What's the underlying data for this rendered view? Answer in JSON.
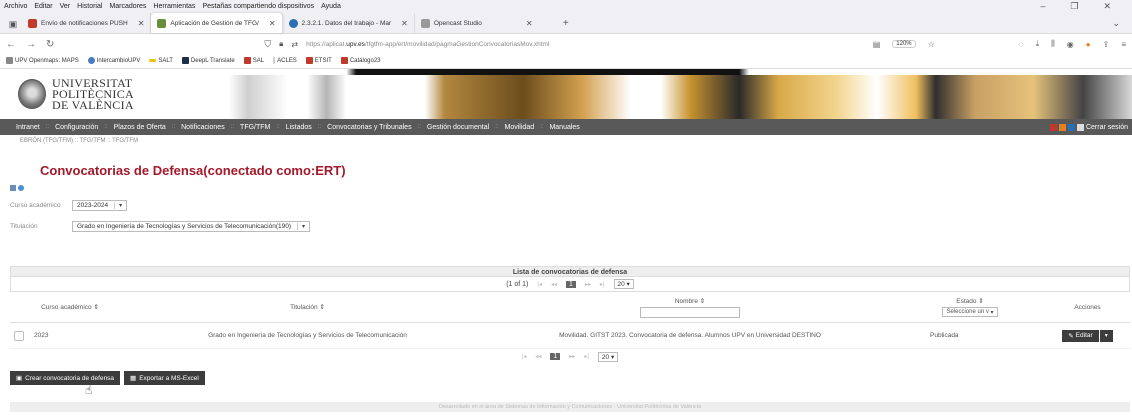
{
  "browser": {
    "menu": [
      "Archivo",
      "Editar",
      "Ver",
      "Historial",
      "Marcadores",
      "Herramientas",
      "Pestañas compartiendo dispositivos",
      "Ayuda"
    ],
    "tabs": [
      {
        "label": "Envío de notificaciones PUSH",
        "color": "#c0392b"
      },
      {
        "label": "Aplicación de Gestión de TFG/",
        "color": "#6a8f3a"
      },
      {
        "label": "2.3.2.1. Datos del trabajo - Mar",
        "color": "#2a6fb5"
      },
      {
        "label": "Opencast Studio",
        "color": "#999999"
      }
    ],
    "url_prefix": "https://aplicat.",
    "url_domain": "upv.es",
    "url_rest": "/tfgtfm-app/ert/movilidad/pagmaGestionConvocatoriasMov.xhtml",
    "zoom": "120%",
    "bookmarks": [
      {
        "label": "UPV Openmaps: MAPS",
        "color": "#888888"
      },
      {
        "label": "IntercambioUPV",
        "color": "#4a7abf"
      },
      {
        "label": "SALT",
        "color": "#f1c40f"
      },
      {
        "label": "DeepL Translate",
        "color": "#1c2e4a"
      },
      {
        "label": "SAL",
        "color": "#c0392b"
      },
      {
        "label": "ACLES",
        "color": "#cccccc"
      },
      {
        "label": "ETSIT",
        "color": "#c0392b"
      },
      {
        "label": "Catálogo23",
        "color": "#c0392b"
      }
    ]
  },
  "site": {
    "logo_lines": [
      "UNIVERSITAT",
      "POLITÈCNICA",
      "DE VALÈNCIA"
    ],
    "nav": [
      "Intranet",
      "Configuración",
      "Plazos de Oferta",
      "Notificaciones",
      "TFG/TFM",
      "Listados",
      "Convocatorias y Tribunales",
      "Gestión documental",
      "Movilidad",
      "Manuales"
    ],
    "logout": "Cerrar sesión",
    "breadcrumb": "EBRÓN (TFG/TFM) :: TFG/TFM :: TFG/TFM"
  },
  "page": {
    "title": "Convocatorias de Defensa(conectado como:ERT)",
    "curso_label": "Curso académico",
    "curso_value": "2023-2024",
    "titulacion_label": "Titulación",
    "titulacion_value": "Grado en Ingeniería de Tecnologías y Servicios de Telecomunicación(190)"
  },
  "table": {
    "caption": "Lista de convocatorias de defensa",
    "page_info": "(1 of 1)",
    "current_page": "1",
    "rows_per_page": "20",
    "headers": {
      "curso": "Curso académico ⇕",
      "titulacion": "Titulación ⇕",
      "nombre": "Nombre ⇕",
      "estado": "Estado ⇕",
      "estado_placeholder": "Seleccione un v",
      "acciones": "Acciones"
    },
    "rows": [
      {
        "curso": "2023",
        "titulacion": "Grado en Ingeniería de Tecnologías y Servicios de Telecomunicación",
        "nombre": "Movilidad. GITST 2023. Convocatoria de defensa. Alumnos UPV en Universidad DESTINO",
        "estado": "Publicada",
        "edit_label": "Editar"
      }
    ]
  },
  "actions": {
    "create": "Crear convocatoria de defensa",
    "export": "Exportar a MS-Excel"
  },
  "footer": "Desarrollado en el área de Sistemas de Información y Comunicaciones - Universitat Politècnica de València"
}
